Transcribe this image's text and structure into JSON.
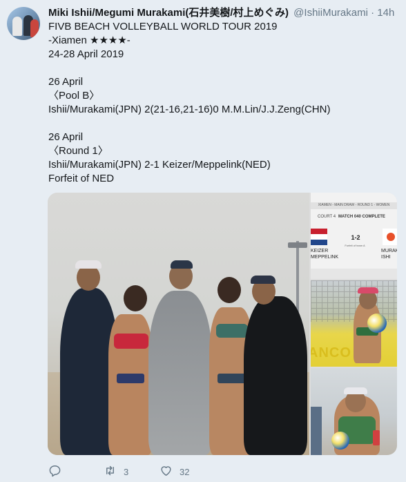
{
  "tweet": {
    "display_name": "Miki Ishii/Megumi Murakami(石井美樹/村上めぐみ)",
    "handle": "@IshiiMurakami",
    "separator": "·",
    "time": "14h",
    "lines": [
      "FIVB BEACH VOLLEYBALL WORLD TOUR 2019",
      "-Xiamen ★★★★-",
      "24-28 April 2019",
      "",
      "26 April",
      "〈Pool B〉",
      "Ishii/Murakami(JPN) 2(21-16,21-16)0 M.M.Lin/J.J.Zeng(CHN)",
      "",
      "26 April",
      "〈Round 1〉",
      "Ishii/Murakami(JPN) 2-1 Keizer/Meppelink(NED)",
      "Forfeit of NED"
    ]
  },
  "media": {
    "scoreboard": {
      "title": "XIAMEN - MAIN DRAW - ROUND 1 - WOMEN",
      "court": "COURT 4",
      "match": "MATCH 040 COMPLETE",
      "score": "1-2",
      "note": "Forfeit of team A",
      "team_left": [
        "KEIZER",
        "MEPPELINK"
      ],
      "team_right": [
        "MURAKA",
        "ISHI"
      ]
    },
    "banner_text": "ANCO"
  },
  "actions": {
    "reply": {
      "icon": "reply-icon",
      "count": ""
    },
    "retweet": {
      "icon": "retweet-icon",
      "count": "3"
    },
    "like": {
      "icon": "heart-icon",
      "count": "32"
    }
  },
  "colors": {
    "background": "#e7edf3",
    "text": "#14171a",
    "secondary": "#657786"
  }
}
